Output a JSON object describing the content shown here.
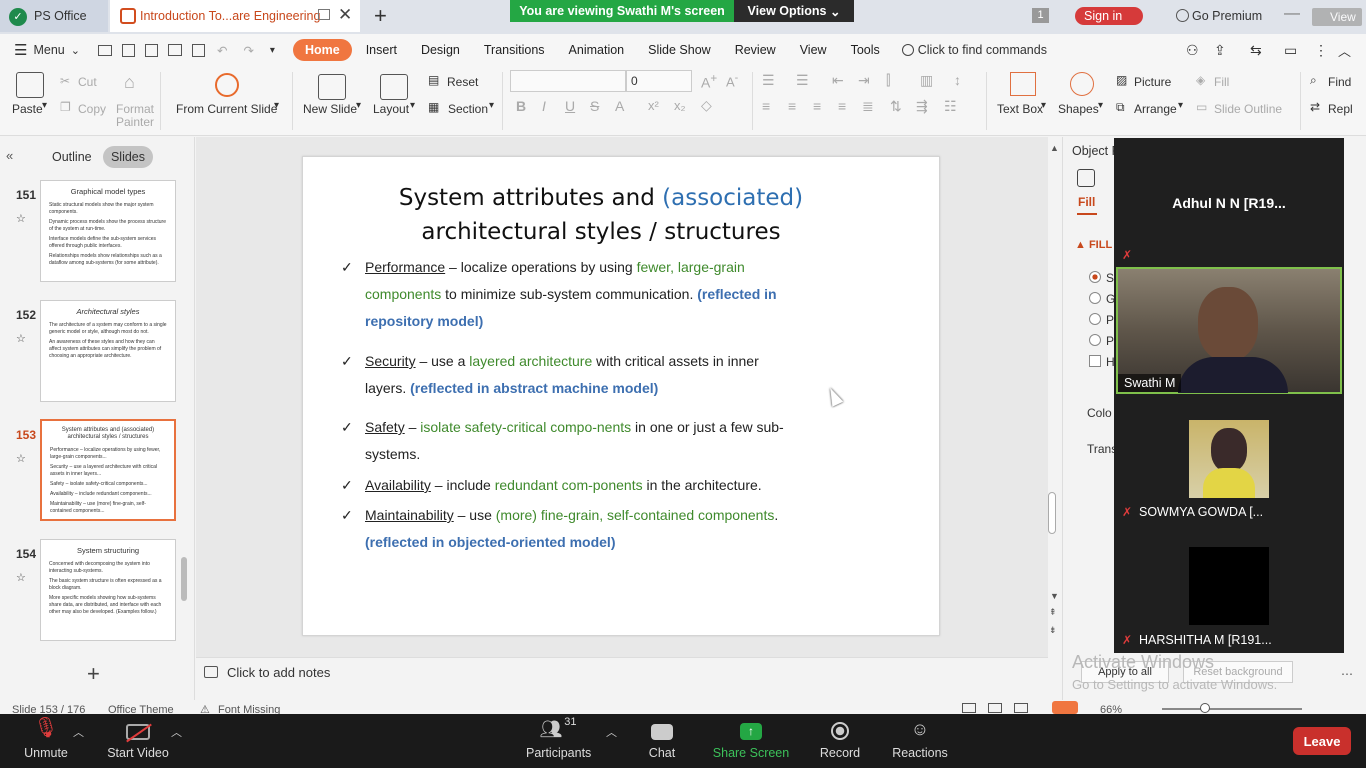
{
  "titlebar": {
    "app_tab": "PS Office",
    "doc_tab": "Introduction To...are Engineering",
    "new_tab_glyph": "+",
    "zoom_banner_text": "You are viewing Swathi M's screen",
    "view_options": "View Options",
    "badge": "1",
    "sign_in": "Sign in",
    "go_premium": "Go Premium",
    "view_label": "View"
  },
  "menubar": {
    "menu_label": "Menu",
    "tabs": [
      "Home",
      "Insert",
      "Design",
      "Transitions",
      "Animation",
      "Slide Show",
      "Review",
      "View",
      "Tools"
    ],
    "active_tab": "Home",
    "search_placeholder": "Click to find commands"
  },
  "ribbon": {
    "paste": "Paste",
    "cut": "Cut",
    "copy": "Copy",
    "format_painter_1": "Format",
    "format_painter_2": "Painter",
    "from_current_slide": "From Current Slide",
    "new_slide": "New Slide",
    "layout": "Layout",
    "reset": "Reset",
    "section": "Section",
    "font_size": "0",
    "picture": "Picture",
    "fill": "Fill",
    "text_box": "Text Box",
    "shapes": "Shapes",
    "arrange": "Arrange",
    "slide_outline": "Slide Outline",
    "find": "Find",
    "replace": "Repl"
  },
  "leftpanel": {
    "outline_tab": "Outline",
    "slides_tab": "Slides",
    "thumbs": [
      {
        "num": "151",
        "title": "Graphical model types",
        "lines": [
          "Static structural models show the major system components.",
          "Dynamic process models show the process structure of the system at run-time.",
          "Interface models define the sub-system services offered through public interfaces.",
          "Relationships models show relationships such as a dataflow among sub-systems (for some attribute)."
        ]
      },
      {
        "num": "152",
        "title": "Architectural styles",
        "lines": [
          "The architecture of a system may conform to a single generic model or style, although most do not.",
          "An awareness of these styles and how they can affect system attributes can simplify the problem of choosing an appropriate architecture."
        ]
      },
      {
        "num": "153",
        "title": "System attributes and (associated) architectural styles / structures",
        "lines": [
          "Performance – localize operations by using fewer, large-grain components...",
          "Security – use a layered architecture with critical assets in inner layers...",
          "Safety – isolate safety-critical components...",
          "Availability – include redundant components...",
          "Maintainability – use (more) fine-grain, self-contained components..."
        ]
      },
      {
        "num": "154",
        "title": "System structuring",
        "lines": [
          "Concerned with decomposing the system into interacting sub-systems.",
          "The basic system structure is often expressed as a block diagram.",
          "More specific models showing how sub-systems share data, are distributed, and interface with each other may also be developed. (Examples follow.)"
        ]
      }
    ],
    "add_glyph": "+"
  },
  "slide": {
    "title_part1": "System attributes and ",
    "title_accent": "(associated)",
    "title_line2": "architectural styles / structures",
    "bullets": [
      {
        "check": "✓",
        "head": "Performance",
        "t1": " – localize operations by using ",
        "g1": "fewer, large-grain components",
        "t2": " to minimize sub-system communication.  ",
        "b1": "(reflected in repository model)"
      },
      {
        "check": "✓",
        "head": "Security",
        "t1": " – use a ",
        "g1": "layered architecture",
        "t2": " with critical assets in inner layers. ",
        "b1": "(reflected in abstract machine model)"
      },
      {
        "check": "✓",
        "head": "Safety",
        "t1": " – ",
        "g1": "isolate safety-critical compo-nents",
        "t2": " in one or just a few sub-systems.",
        "b1": ""
      },
      {
        "check": "✓",
        "head": "Availability",
        "t1": " – include ",
        "g1": "redundant com-ponents",
        "t2": " in the architecture.",
        "b1": ""
      },
      {
        "check": "✓",
        "head": "Maintainability",
        "t1": " – use ",
        "g1": "(more) fine-grain, self-contained components",
        "t2": ".",
        "b1": "(reflected in objected-oriented model)"
      }
    ]
  },
  "notes_placeholder": "Click to add notes",
  "rightpanel": {
    "title": "Object F",
    "fill_tab": "Fill",
    "fill_section": "FILL",
    "options": [
      "Sc",
      "G",
      "Pi",
      "Pa",
      "Hi"
    ],
    "color_label": "Colo",
    "trans_label": "Trans",
    "apply_to_all": "Apply to all",
    "reset_background": "Reset background"
  },
  "zoom_participants": {
    "top_name": "Adhul N N [R19...",
    "p1": "Swathi M",
    "p2": "SOWMYA GOWDA [...",
    "p3": "HARSHITHA M [R191..."
  },
  "watermark": {
    "line1": "Activate Windows",
    "line2": "Go to Settings to activate Windows."
  },
  "statusbar": {
    "slide_info": "Slide 153 / 176",
    "theme": "Office Theme",
    "font_missing": "Font Missing",
    "zoom": "66%"
  },
  "zoom_controls": {
    "unmute": "Unmute",
    "start_video": "Start Video",
    "participants": "Participants",
    "participant_count": "31",
    "chat": "Chat",
    "share_screen": "Share Screen",
    "record": "Record",
    "reactions": "Reactions",
    "leave": "Leave"
  },
  "colors": {
    "accent_orange": "#f07640",
    "zoom_green": "#24a744",
    "leave_red": "#c9302c",
    "slide_blue": "#2e6fb1",
    "slide_green": "#3f8a2c"
  }
}
